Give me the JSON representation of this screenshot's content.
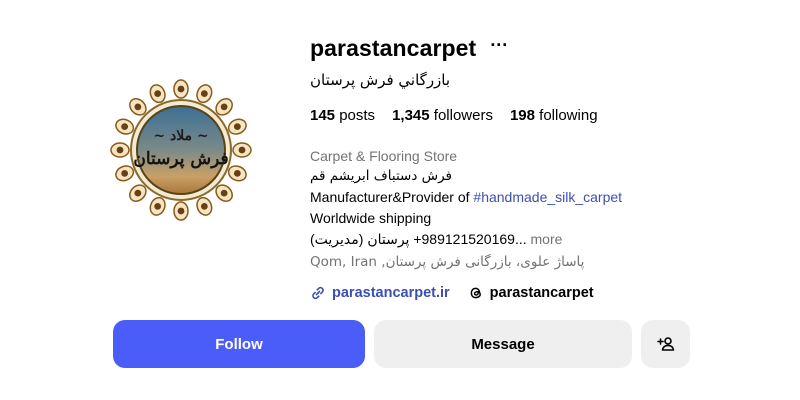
{
  "profile": {
    "username": "parastancarpet",
    "more_icon": "more-horizontal-icon",
    "full_name": "بازرگاني فرش پرستان",
    "avatar_text": "فرش پرستان"
  },
  "stats": {
    "posts_count": "145",
    "posts_label": " posts",
    "followers_count": "1,345",
    "followers_label": " followers",
    "following_count": "198",
    "following_label": " following"
  },
  "bio": {
    "category": "Carpet & Flooring Store",
    "line1": "فرش دستباف ابریشم قم",
    "line2_prefix": "Manufacturer&Provider of ",
    "line2_hashtag": "#handmade_silk_carpet",
    "line3": "Worldwide shipping",
    "line4": "989121520169+ پرستان (مدیریت)",
    "line4_ellipsis": "... ",
    "more_label": "more",
    "address": "پاساژ علوی، بازرگانی فرش پرستان, Qom, Iran"
  },
  "links": {
    "website": "parastancarpet.ir",
    "website_icon": "link-icon",
    "threads": "parastancarpet",
    "threads_icon": "threads-icon"
  },
  "buttons": {
    "follow_label": "Follow",
    "message_label": "Message",
    "suggest_icon": "add-person-icon"
  },
  "colors": {
    "accent": "#4a5df9",
    "link": "#3d4fb1",
    "secondary_text": "#737373",
    "button_gray": "#efefef"
  }
}
